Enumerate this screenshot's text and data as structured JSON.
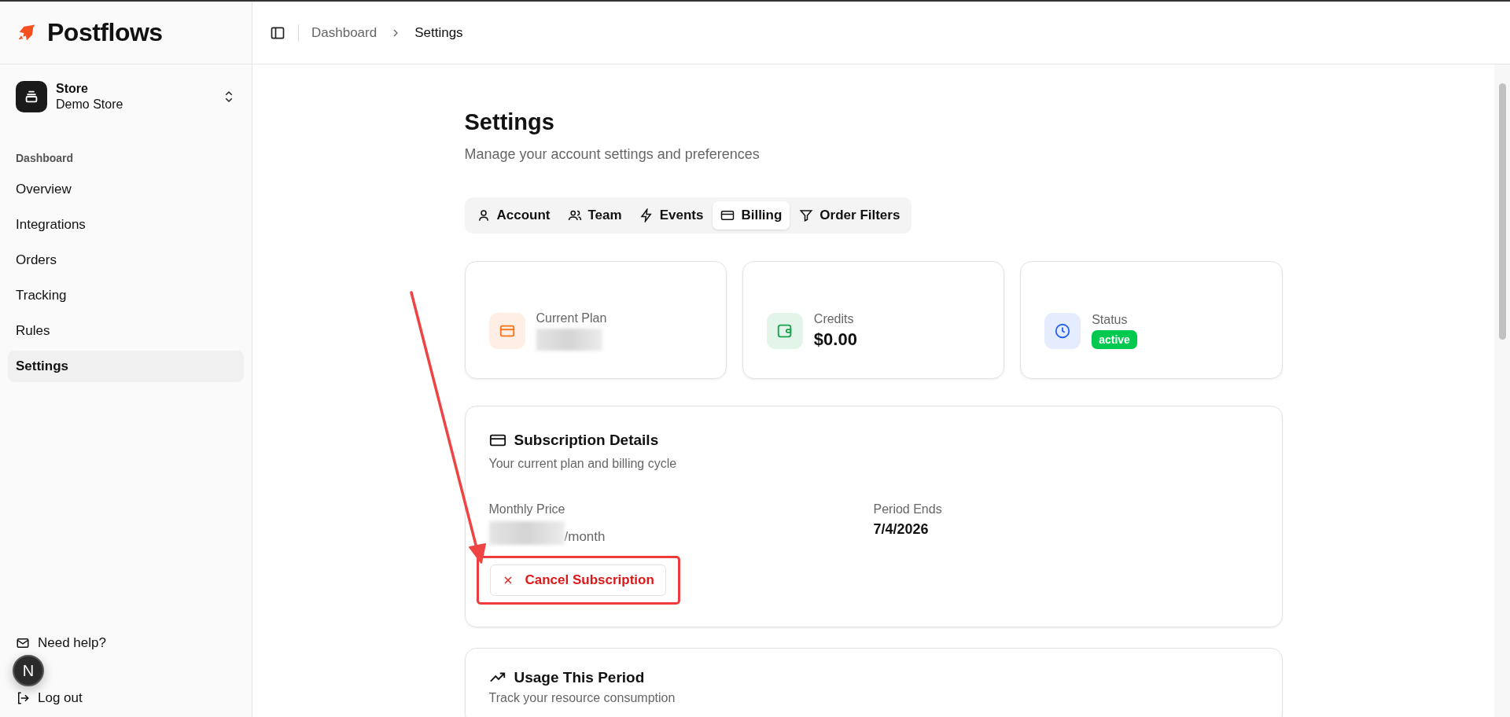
{
  "brand": {
    "name": "Postflows"
  },
  "store": {
    "label": "Store",
    "name": "Demo Store"
  },
  "sidebar": {
    "section": "Dashboard",
    "items": [
      {
        "label": "Overview",
        "selected": false
      },
      {
        "label": "Integrations",
        "selected": false
      },
      {
        "label": "Orders",
        "selected": false
      },
      {
        "label": "Tracking",
        "selected": false
      },
      {
        "label": "Rules",
        "selected": false
      },
      {
        "label": "Settings",
        "selected": true
      }
    ],
    "footer": [
      {
        "label": "Need help?"
      },
      {
        "label": "Log out"
      }
    ]
  },
  "breadcrumb": [
    "Dashboard",
    "Settings"
  ],
  "page": {
    "title": "Settings",
    "subtitle": "Manage your account settings and preferences"
  },
  "tabs": [
    {
      "label": "Account",
      "selected": false
    },
    {
      "label": "Team",
      "selected": false
    },
    {
      "label": "Events",
      "selected": false
    },
    {
      "label": "Billing",
      "selected": true
    },
    {
      "label": "Order Filters",
      "selected": false
    }
  ],
  "stats": [
    {
      "label": "Current Plan",
      "kind": "redacted",
      "color": "#f97316"
    },
    {
      "label": "Credits",
      "kind": "value",
      "value": "$0.00",
      "color": "#16a34a"
    },
    {
      "label": "Status",
      "kind": "badge",
      "value": "active",
      "color": "#2563eb"
    }
  ],
  "subscription": {
    "title": "Subscription Details",
    "subtitle": "Your current plan and billing cycle",
    "fields": [
      {
        "label": "Monthly Price",
        "value": "/month",
        "redacted": true
      },
      {
        "label": "Period Ends",
        "value": "7/4/2026",
        "redacted": false
      }
    ],
    "cancel_button": "Cancel Subscription",
    "highlighted": true
  },
  "usage": {
    "title": "Usage This Period",
    "subtitle": "Track your resource consumption"
  },
  "dev_indicator": {
    "label": "N"
  }
}
